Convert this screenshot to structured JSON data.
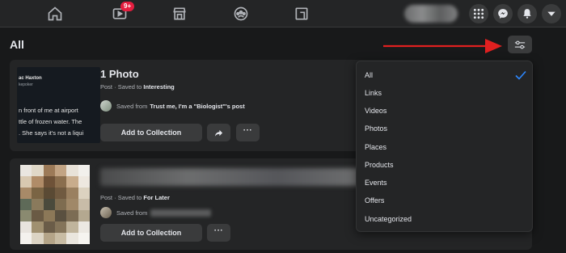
{
  "nav": {
    "watch_badge": "9+",
    "icons": [
      "home-icon",
      "watch-icon",
      "marketplace-icon",
      "groups-icon",
      "gaming-icon"
    ]
  },
  "header": {
    "title": "All"
  },
  "items": [
    {
      "title": "1 Photo",
      "type": "Post",
      "saved_to_prefix": "Saved to",
      "collection": "Interesting",
      "source_prefix": "Saved from",
      "source_name": "Trust me, I'm a \"Biologist\"'s post",
      "thumbnail": {
        "author": "ac Haxton",
        "handle": "kepoker",
        "lines": [
          "n front of me at airport",
          "ttle of frozen water. The",
          ". She says it's not a liqui"
        ]
      },
      "add_label": "Add to Collection",
      "more_label": "···"
    },
    {
      "type": "Post",
      "saved_to_prefix": "Saved to",
      "collection": "For Later",
      "source_prefix": "Saved from",
      "add_label": "Add to Collection",
      "more_label": "···"
    }
  ],
  "filter_menu": {
    "selected": "All",
    "options": [
      "All",
      "Links",
      "Videos",
      "Photos",
      "Places",
      "Products",
      "Events",
      "Offers",
      "Uncategorized"
    ]
  },
  "colors": {
    "background": "#18191a",
    "surface": "#242526",
    "button": "#3a3b3c",
    "accent": "#2d88ff",
    "badge": "#e41e3f",
    "annotation_arrow": "#e02020"
  }
}
